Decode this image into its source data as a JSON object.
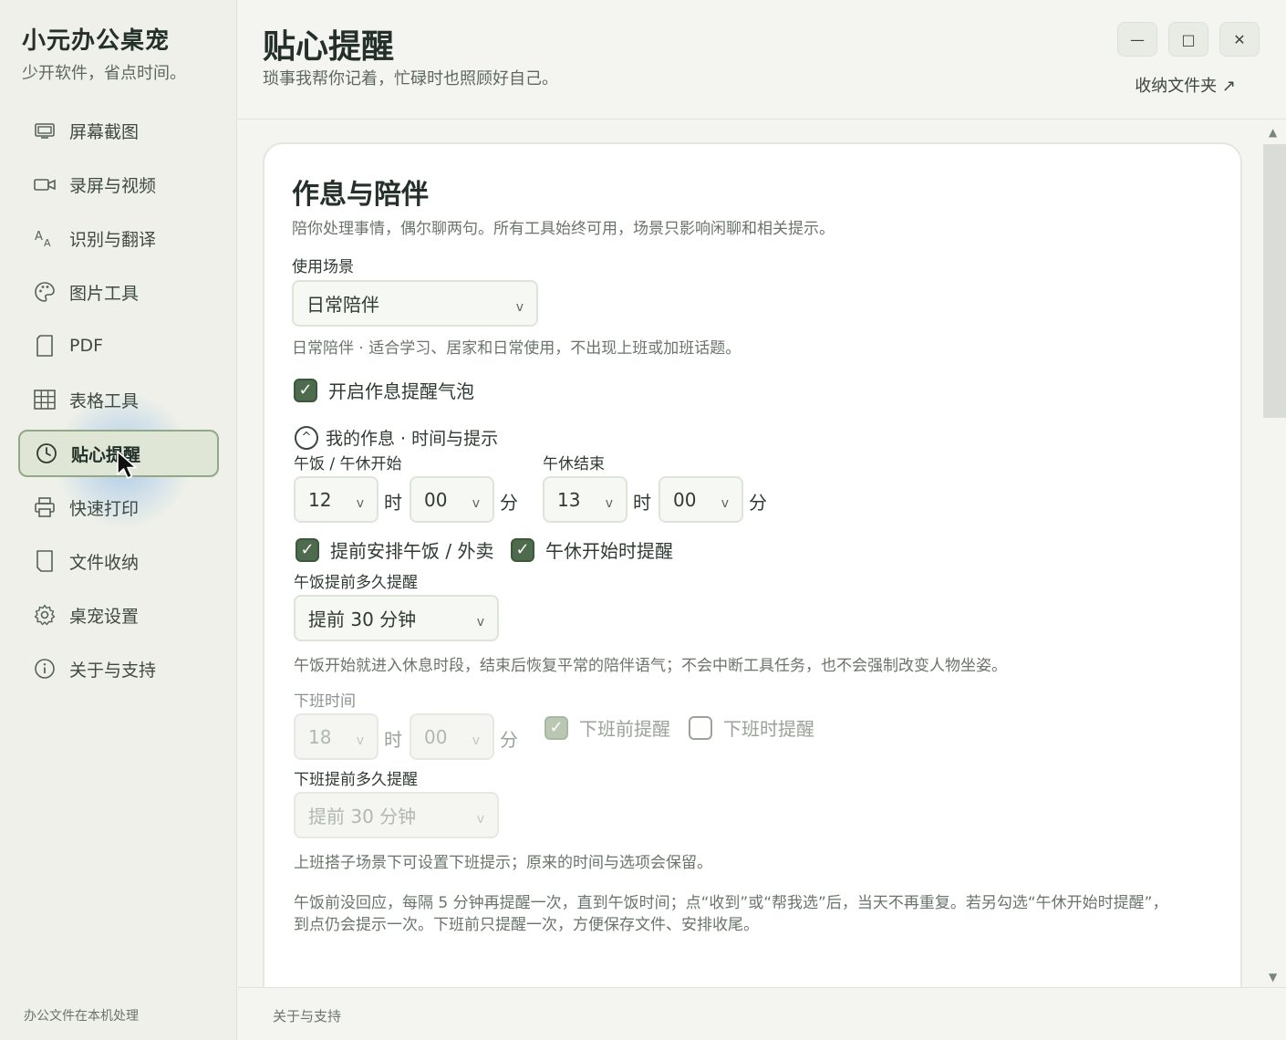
{
  "app": {
    "title": "小元办公桌宠",
    "subtitle": "少开软件，省点时间。"
  },
  "sidebar": {
    "items": [
      {
        "label": "屏幕截图",
        "icon": "screenshot-icon"
      },
      {
        "label": "录屏与视频",
        "icon": "video-camera-icon"
      },
      {
        "label": "识别与翻译",
        "icon": "translate-icon"
      },
      {
        "label": "图片工具",
        "icon": "palette-icon"
      },
      {
        "label": "PDF",
        "icon": "document-icon"
      },
      {
        "label": "表格工具",
        "icon": "table-grid-icon"
      },
      {
        "label": "贴心提醒",
        "icon": "clock-icon",
        "active": true
      },
      {
        "label": "快速打印",
        "icon": "printer-icon"
      },
      {
        "label": "文件收纳",
        "icon": "file-icon"
      },
      {
        "label": "桌宠设置",
        "icon": "gear-icon"
      },
      {
        "label": "关于与支持",
        "icon": "info-icon"
      }
    ],
    "footer": "办公文件在本机处理"
  },
  "header": {
    "title": "贴心提醒",
    "subtitle": "琐事我帮你记着，忙碌时也照顾好自己。",
    "folder_link": "收纳文件夹 ↗",
    "window_buttons": {
      "minimize": "—",
      "maximize": "□",
      "close": "✕"
    }
  },
  "card": {
    "title": "作息与陪伴",
    "description": "陪你处理事情，偶尔聊两句。所有工具始终可用，场景只影响闲聊和相关提示。",
    "scene_label": "使用场景",
    "scene_value": "日常陪伴",
    "scene_note": "日常陪伴 · 适合学习、居家和日常使用，不出现上班或加班话题。",
    "enable_bubble": {
      "label": "开启作息提醒气泡",
      "checked": true
    },
    "section_toggle": "我的作息 · 时间与提示",
    "lunch_start": {
      "label": "午饭 / 午休开始",
      "hour": "12",
      "minute": "00"
    },
    "lunch_end": {
      "label": "午休结束",
      "hour": "13",
      "minute": "00"
    },
    "units": {
      "hour": "时",
      "minute": "分"
    },
    "arrange_lunch": {
      "label": "提前安排午饭 / 外卖",
      "checked": true
    },
    "nap_start_reminder": {
      "label": "午休开始时提醒",
      "checked": true
    },
    "lunch_advance_label": "午饭提前多久提醒",
    "lunch_advance_value": "提前 30 分钟",
    "lunch_note": "午饭开始就进入休息时段，结束后恢复平常的陪伴语气；不会中断工具任务，也不会强制改变人物坐姿。",
    "offwork": {
      "label": "下班时间",
      "hour": "18",
      "minute": "00"
    },
    "before_offwork": {
      "label": "下班前提醒",
      "checked": true
    },
    "at_offwork": {
      "label": "下班时提醒",
      "checked": false
    },
    "offwork_advance_label": "下班提前多久提醒",
    "offwork_advance_value": "提前 30 分钟",
    "offwork_note": "上班搭子场景下可设置下班提示；原来的时间与选项会保留。",
    "repeat_note_line1": "午饭前没回应，每隔 5 分钟再提醒一次，直到午饭时间；点“收到”或“帮我选”后，当天不再重复。若另勾选“午休开始时提醒”，",
    "repeat_note_line2": "到点仍会提示一次。下班前只提醒一次，方便保存文件、安排收尾。"
  },
  "footer": {
    "text": "关于与支持"
  },
  "colors": {
    "accent": "#4e6b4e",
    "sidebar_bg": "#eef0e9",
    "active_bg": "#dfe6d6",
    "active_border": "#93a886"
  }
}
